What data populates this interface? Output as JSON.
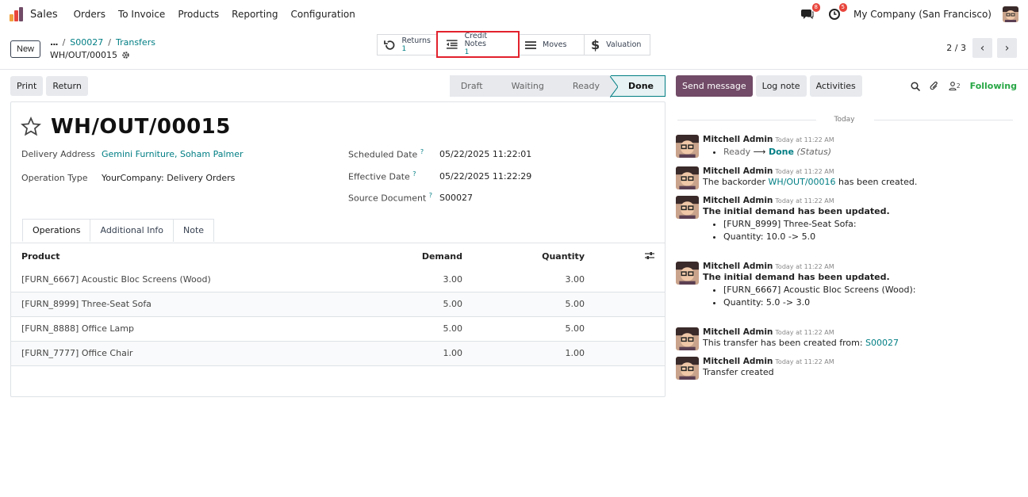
{
  "navbar": {
    "app_name": "Sales",
    "menu": [
      "Orders",
      "To Invoice",
      "Products",
      "Reporting",
      "Configuration"
    ],
    "messages_badge": "8",
    "activities_badge": "5",
    "company": "My Company (San Francisco)"
  },
  "control": {
    "new_label": "New",
    "breadcrumb_dots": "...",
    "breadcrumb": [
      "S00027",
      "Transfers"
    ],
    "record_name": "WH/OUT/00015",
    "smart_buttons": [
      {
        "label": "Returns",
        "count": "1",
        "icon": "undo-icon"
      },
      {
        "label": "Credit Notes",
        "count": "1",
        "icon": "outdent-icon"
      },
      {
        "label": "Moves",
        "count": "",
        "icon": "list-icon"
      },
      {
        "label": "Valuation",
        "count": "",
        "icon": "dollar-icon"
      }
    ],
    "pager": "2 / 3"
  },
  "statusbar": {
    "print_label": "Print",
    "return_label": "Return",
    "states": [
      "Draft",
      "Waiting",
      "Ready",
      "Done"
    ],
    "active_state": "Done"
  },
  "form": {
    "title": "WH/OUT/00015",
    "delivery_address_label": "Delivery Address",
    "delivery_address": "Gemini Furniture, Soham Palmer",
    "operation_type_label": "Operation Type",
    "operation_type": "YourCompany: Delivery Orders",
    "scheduled_date_label": "Scheduled Date",
    "scheduled_date": "05/22/2025 11:22:01",
    "effective_date_label": "Effective Date",
    "effective_date": "05/22/2025 11:22:29",
    "source_document_label": "Source Document",
    "source_document": "S00027",
    "help_mark": "?",
    "tabs": [
      "Operations",
      "Additional Info",
      "Note"
    ],
    "table": {
      "headers": [
        "Product",
        "Demand",
        "Quantity"
      ],
      "rows": [
        {
          "product": "[FURN_6667] Acoustic Bloc Screens (Wood)",
          "demand": "3.00",
          "quantity": "3.00"
        },
        {
          "product": "[FURN_8999] Three-Seat Sofa",
          "demand": "5.00",
          "quantity": "5.00"
        },
        {
          "product": "[FURN_8888] Office Lamp",
          "demand": "5.00",
          "quantity": "5.00"
        },
        {
          "product": "[FURN_7777] Office Chair",
          "demand": "1.00",
          "quantity": "1.00"
        }
      ]
    }
  },
  "chatter": {
    "send_message": "Send message",
    "log_note": "Log note",
    "activities": "Activities",
    "followers_count": "2",
    "following": "Following",
    "today": "Today",
    "messages": [
      {
        "author": "Mitchell Admin",
        "date": "Today at 11:22 AM",
        "status_from": "Ready",
        "arrow": "⟶",
        "status_to": "Done",
        "status_field": "(Status)"
      },
      {
        "author": "Mitchell Admin",
        "date": "Today at 11:22 AM",
        "pre": "The backorder ",
        "link": "WH/OUT/00016",
        "post": " has been created."
      },
      {
        "author": "Mitchell Admin",
        "date": "Today at 11:22 AM",
        "heading": "The initial demand has been updated.",
        "items": [
          "[FURN_8999] Three-Seat Sofa:",
          "Quantity: 10.0 -> 5.0"
        ]
      },
      {
        "author": "Mitchell Admin",
        "date": "Today at 11:22 AM",
        "heading": "The initial demand has been updated.",
        "items": [
          "[FURN_6667] Acoustic Bloc Screens (Wood):",
          "Quantity: 5.0 -> 3.0"
        ]
      },
      {
        "author": "Mitchell Admin",
        "date": "Today at 11:22 AM",
        "pre": "This transfer has been created from: ",
        "link": "S00027"
      },
      {
        "author": "Mitchell Admin",
        "date": "Today at 11:22 AM",
        "text": "Transfer created"
      }
    ]
  },
  "colors": {
    "accent": "#017e84",
    "primary": "#714b67",
    "following": "#28a745",
    "highlight": "#e2222d"
  }
}
